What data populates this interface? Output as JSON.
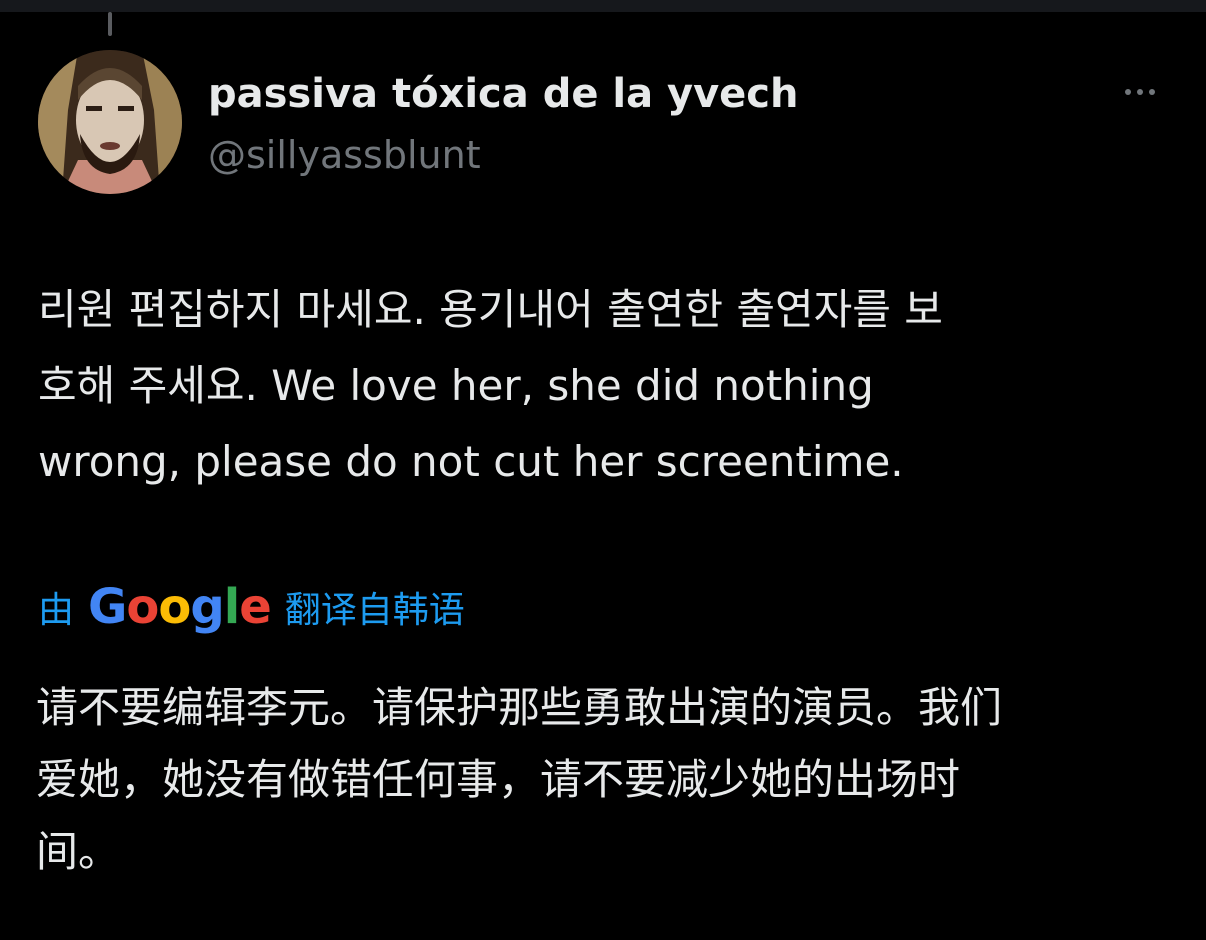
{
  "tweet": {
    "author": {
      "display_name": "passiva tóxica de la yvech",
      "handle": "@sillyassblunt",
      "avatar_icon": "user-avatar"
    },
    "more_icon": "more-horizontal-icon",
    "text_lines": [
      "리원 편집하지 마세요. 용기내어 출연한 출연자를 보",
      "호해 주세요. We love her, she did nothing",
      "wrong, please do not cut her screentime."
    ],
    "translation": {
      "prefix": "由",
      "provider": "Google",
      "suffix": "翻译自韩语",
      "text_lines": [
        "请不要编辑李元。请保护那些勇敢出演的演员。我们",
        "爱她，她没有做错任何事，请不要减少她的出场时",
        "间。"
      ]
    }
  },
  "colors": {
    "background": "#000000",
    "primary_text": "#e7e9ea",
    "secondary_text": "#71767b",
    "link": "#1d9bf0",
    "google_blue": "#4285f4",
    "google_red": "#ea4335",
    "google_yellow": "#fbbc05",
    "google_green": "#34a853"
  }
}
